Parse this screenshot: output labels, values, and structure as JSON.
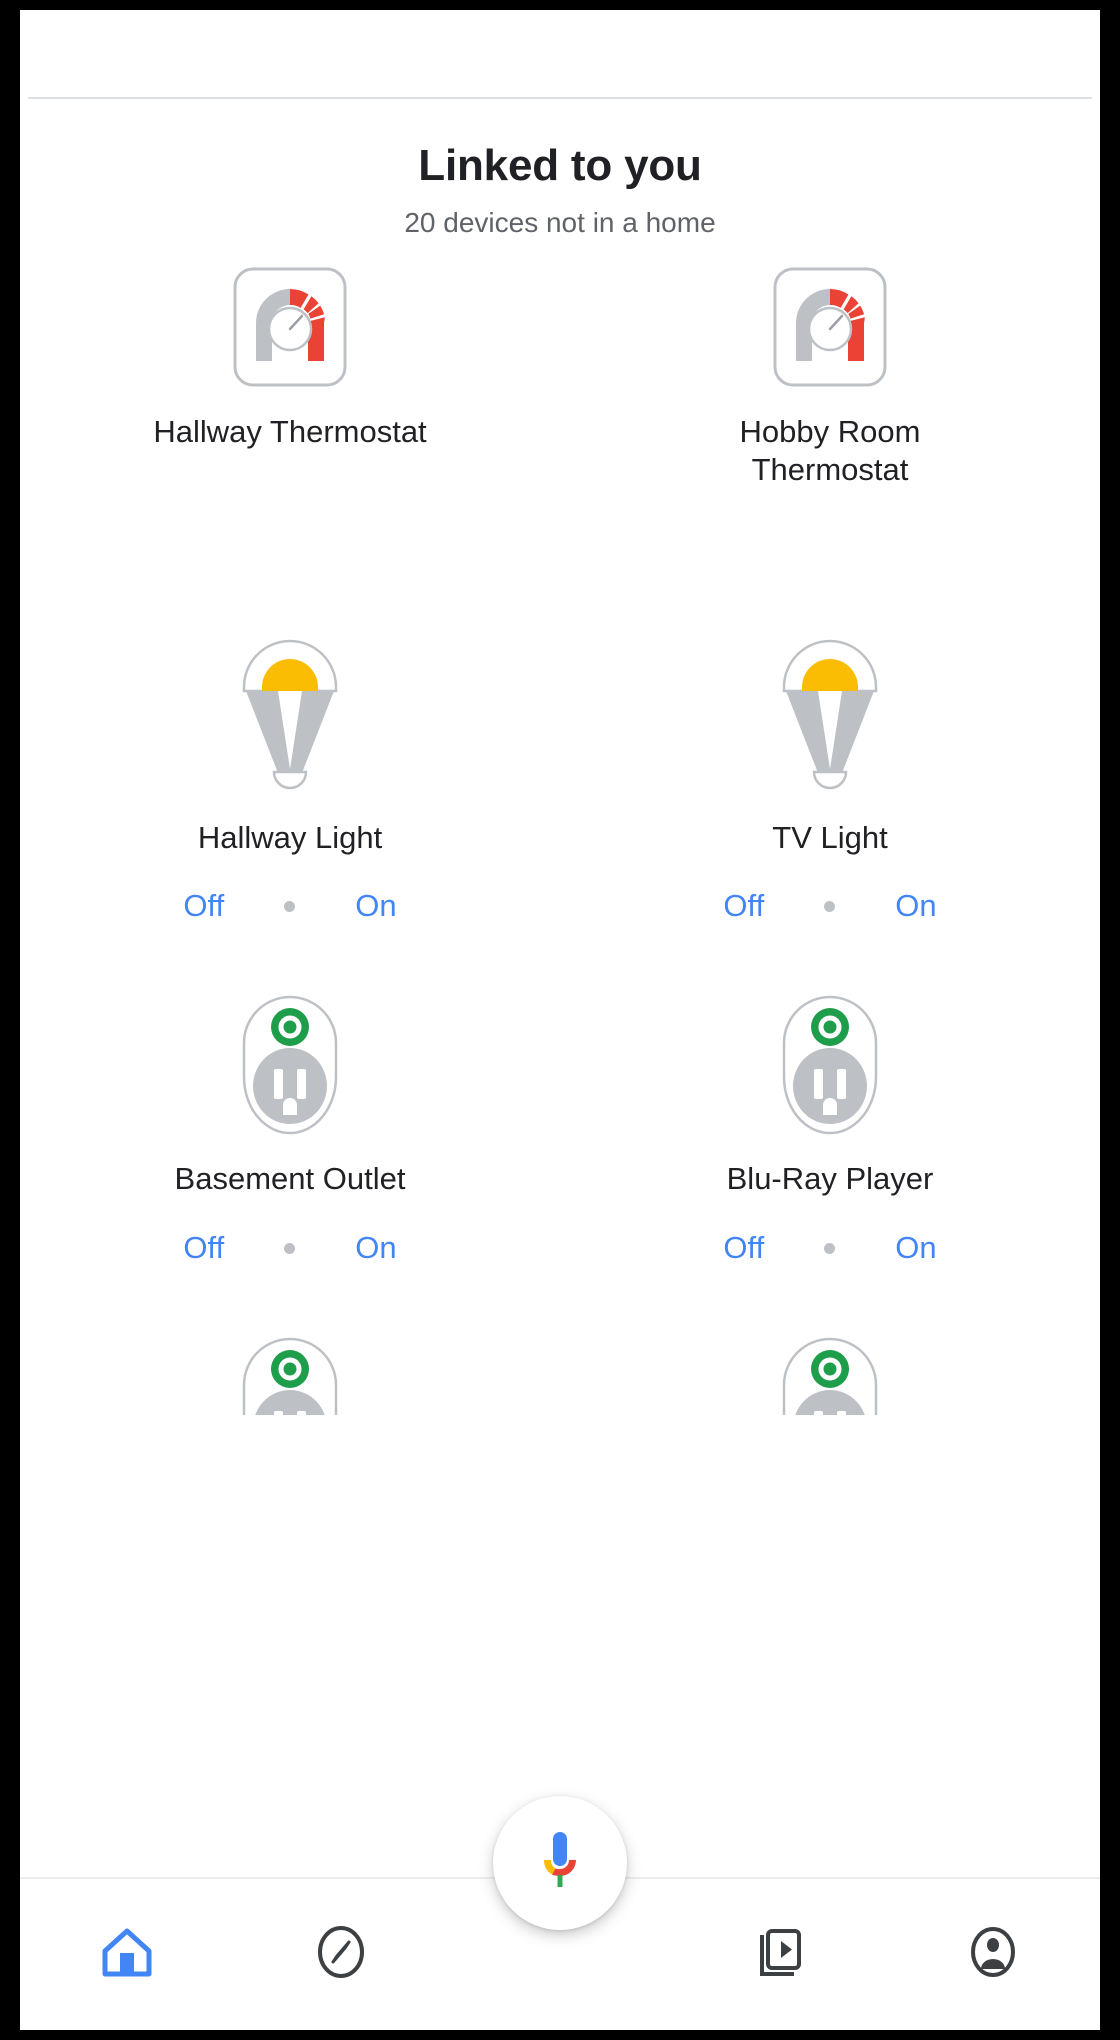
{
  "app": {
    "accent_blue": "#4285f4",
    "icon_gray": "#bdc1c6",
    "thermostat_red": "#ea4335",
    "bulb_yellow": "#fbbc04",
    "outlet_green": "#1e9e4a"
  },
  "header": {
    "title": "Linked to you",
    "subtitle": "20 devices not in a home"
  },
  "controls": {
    "off_label": "Off",
    "on_label": "On"
  },
  "devices": [
    {
      "name": "Hallway Thermostat",
      "type": "thermostat",
      "icon": "thermostat-gauge-icon",
      "has_controls": false
    },
    {
      "name": "Hobby Room Thermostat",
      "type": "thermostat",
      "icon": "thermostat-gauge-icon",
      "has_controls": false
    },
    {
      "name": "Hallway Light",
      "type": "light",
      "icon": "light-bulb-icon",
      "has_controls": true
    },
    {
      "name": "TV Light",
      "type": "light",
      "icon": "light-bulb-icon",
      "has_controls": true
    },
    {
      "name": "Basement Outlet",
      "type": "outlet",
      "icon": "power-outlet-icon",
      "has_controls": true
    },
    {
      "name": "Blu-Ray Player",
      "type": "outlet",
      "icon": "power-outlet-icon",
      "has_controls": true
    }
  ],
  "assistant": {
    "icon": "assistant-microphone-icon"
  },
  "bottom_nav": [
    {
      "icon": "home-icon",
      "active": true
    },
    {
      "icon": "explore-compass-icon",
      "active": false
    },
    {
      "icon": "media-cast-icon",
      "active": false
    },
    {
      "icon": "account-icon",
      "active": false
    }
  ]
}
